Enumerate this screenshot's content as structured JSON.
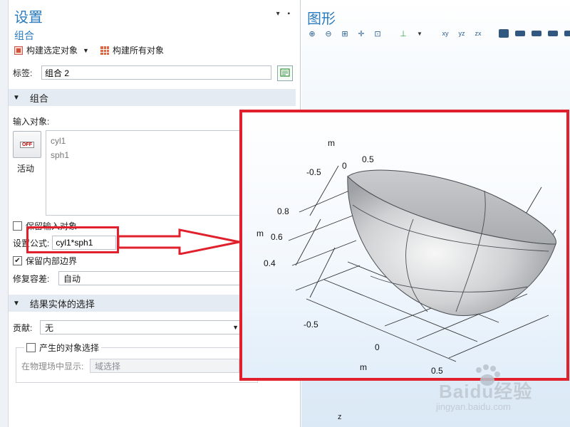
{
  "settings": {
    "title": "设置",
    "subtitle": "组合",
    "toolbar": {
      "build_selected": "构建选定对象",
      "build_all": "构建所有对象"
    },
    "label_field": {
      "label": "标签:",
      "value": "组合 2"
    },
    "section_combine": {
      "title": "组合",
      "input_objects_label": "输入对象:",
      "active_label": "活动",
      "off_badge": "OFF",
      "objects": [
        "cyl1",
        "sph1"
      ],
      "keep_input_label": "保留输入对象",
      "keep_input_checked": false,
      "formula_label": "设置公式:",
      "formula_value": "cyl1*sph1",
      "keep_interior_label": "保留内部边界",
      "keep_interior_checked": true,
      "repair_label": "修复容差:",
      "repair_value": "自动"
    },
    "section_selection": {
      "title": "结果实体的选择",
      "contribute_label": "贡献:",
      "contribute_value": "无",
      "generated_selection_label": "产生的对象选择",
      "generated_selection_checked": false,
      "show_in_physics_label": "在物理场中显示:",
      "show_in_physics_value": "域选择"
    }
  },
  "graphics": {
    "title": "图形",
    "axis_labels": {
      "top_m": "m",
      "x_m": "m",
      "y_m": "m",
      "z": "z",
      "top_ticks": [
        "-0.5",
        "0",
        "0.5"
      ],
      "left_ticks": [
        "0.8",
        "0.6",
        "0.4"
      ],
      "bottom_ticks": [
        "-0.5",
        "0",
        "0.5"
      ]
    }
  },
  "watermark": {
    "brand": "Baidu经验",
    "url": "jingyan.baidu.com"
  },
  "colors": {
    "accent": "#2b7bbd",
    "highlight": "#e0212d",
    "section_bg": "#e4ebf2"
  }
}
